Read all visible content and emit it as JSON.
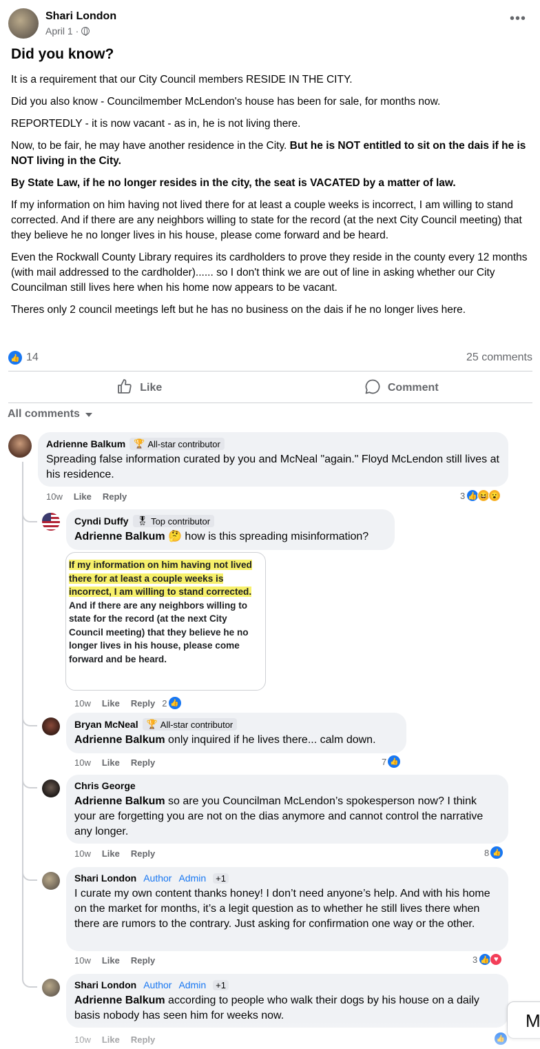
{
  "post": {
    "author": "Shari London",
    "date": "April 1 ·",
    "title": "Did you know?",
    "paragraphs": [
      "It is a requirement that our City Council members RESIDE IN THE CITY.",
      "Did you also know - Councilmember McLendon's house has been for sale, for months now.",
      "REPORTEDLY - it is now vacant - as in, he is not living there."
    ],
    "p4_normal": "Now, to be fair, he may have another residence in the City. ",
    "p4_bold": "But he is NOT entitled to sit on the dais if he is NOT living in the City.",
    "p5_bold": "By State Law, if he no longer resides in the city, the seat is VACATED by a matter of law.",
    "p6": "If my information on him having not lived there for at least a couple weeks is incorrect, I am willing to stand corrected. And if there are any neighbors willing to state for the record (at the next City Council meeting) that they believe he no longer lives in his house, please come forward and be heard.",
    "p7": "Even the Rockwall County Library requires its cardholders to prove they reside in the county every 12 months (with mail addressed to the cardholder)...... so I don't think we are out of line in asking whether our City Councilman still lives here when his home now appears to be vacant.",
    "p8": "Theres only 2 council meetings left but he has no business on the dais if he no longer lives here.",
    "like_count": "14",
    "comments_count": "25 comments",
    "like_label": "Like",
    "comment_label": "Comment",
    "all_comments_label": "All comments"
  },
  "comments": [
    {
      "name": "Adrienne Balkum",
      "badge": "All-star contributor",
      "text": "Spreading false information curated by you and McNeal \"again.\" Floyd McLendon still lives at his residence.",
      "time": "10w",
      "like": "Like",
      "reply": "Reply",
      "reactions": "3"
    },
    {
      "name": "Cyndi Duffy",
      "badge": "Top contributor",
      "mention": "Adrienne Balkum",
      "text": " how is this spreading misinformation?",
      "quote_highlight": "If my information on him having not lived there for at least a couple weeks is incorrect, I am willing to stand corrected.",
      "quote_rest": "  And if there are any neighbors willing to state for the record (at the next City Council meeting) that they believe he no longer lives in his house, please come forward and be heard.",
      "time": "10w",
      "like": "Like",
      "reply": "Reply",
      "reactions": "2"
    },
    {
      "name": "Bryan McNeal",
      "badge": "All-star contributor",
      "mention": "Adrienne Balkum",
      "text": " only inquired if he lives there... calm down.",
      "time": "10w",
      "like": "Like",
      "reply": "Reply",
      "reactions": "7"
    },
    {
      "name": "Chris George",
      "mention": "Adrienne Balkum",
      "text": " so are you Councilman McLendon’s spokesperson now? I think your are forgetting you are not on the dias anymore and cannot control the narrative any longer.",
      "time": "10w",
      "like": "Like",
      "reply": "Reply",
      "reactions": "8"
    },
    {
      "name": "Shari London",
      "role_author": "Author",
      "role_admin": "Admin",
      "plus": "+1",
      "text": "I curate my own content thanks honey! I don’t need anyone’s help. And with his home on the market for months, it’s a legit question as to whether he still lives there when there are rumors to the contrary. Just asking for confirmation one way or the other.",
      "time": "10w",
      "like": "Like",
      "reply": "Reply",
      "reactions": "3"
    },
    {
      "name": "Shari London",
      "role_author": "Author",
      "role_admin": "Admin",
      "plus": "+1",
      "mention": "Adrienne Balkum",
      "text": " according to people who walk their dogs by his house on a daily basis nobody has seen him for weeks now.",
      "time": "10w",
      "like": "Like",
      "reply": "Reply"
    }
  ],
  "side_peek_letter": "M",
  "colors": {
    "accent": "#1877f2",
    "bubble": "#f0f2f5",
    "muted": "#65676b",
    "highlight": "#f7f06a"
  }
}
